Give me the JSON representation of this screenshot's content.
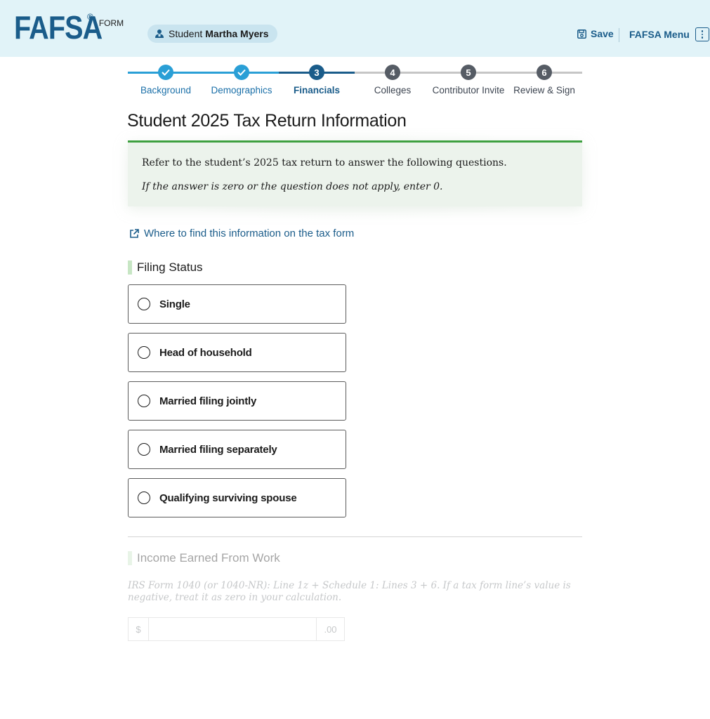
{
  "header": {
    "logo_text": "FAFSA",
    "logo_reg": "®",
    "logo_form": "FORM",
    "student_prefix": "Student",
    "student_name": "Martha Myers",
    "save_label": "Save",
    "menu_label": "FAFSA Menu"
  },
  "stepper": {
    "steps": [
      {
        "number": "1",
        "label": "Background",
        "status": "complete"
      },
      {
        "number": "2",
        "label": "Demographics",
        "status": "complete"
      },
      {
        "number": "3",
        "label": "Financials",
        "status": "current"
      },
      {
        "number": "4",
        "label": "Colleges",
        "status": "upcoming"
      },
      {
        "number": "5",
        "label": "Contributor Invite",
        "status": "upcoming"
      },
      {
        "number": "6",
        "label": "Review & Sign",
        "status": "upcoming"
      }
    ]
  },
  "page": {
    "title": "Student 2025 Tax Return Information",
    "alert_line1": "Refer to the student’s 2025 tax return to answer the following questions.",
    "alert_line2": "If the answer is zero or the question does not apply, enter 0.",
    "tax_link": "Where to find this information on the tax form"
  },
  "filing_status": {
    "title": "Filing Status",
    "options": [
      "Single",
      "Head of household",
      "Married filing jointly",
      "Married filing separately",
      "Qualifying surviving spouse"
    ]
  },
  "income": {
    "title": "Income Earned From Work",
    "hint": "IRS Form 1040 (or 1040-NR): Line 1z + Schedule 1: Lines 3 + 6. If a tax form line’s value is negative, treat it as zero in your calculation.",
    "prefix": "$",
    "suffix": ".00",
    "value": ""
  },
  "colors": {
    "brand_blue": "#1a5c8a",
    "header_bg": "#e1f3f8",
    "progress_active": "#2a9fd6",
    "progress_upcoming": "#c6c6c6",
    "alert_border": "#3ea040",
    "alert_bg": "#ecf3ec"
  }
}
